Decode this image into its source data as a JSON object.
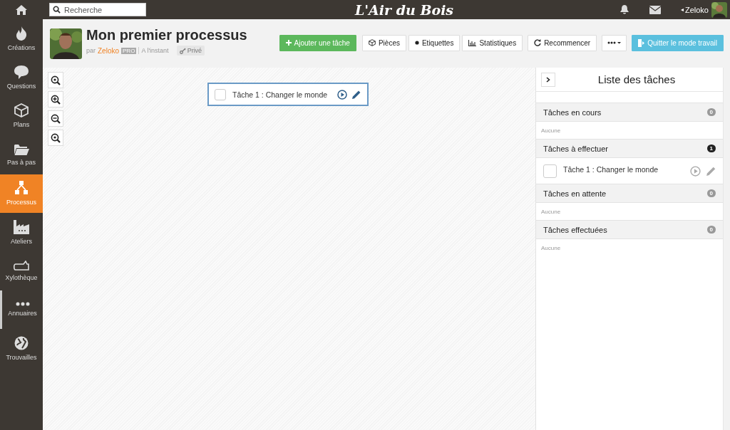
{
  "topbar": {
    "search": {
      "placeholder": "Recherche"
    },
    "logo": "L'Air du Bois",
    "user": {
      "caret": "◂",
      "name": "Zeloko"
    }
  },
  "sidebar": {
    "items": [
      {
        "label": "Créations",
        "selected": false,
        "highlighted": false
      },
      {
        "label": "Questions",
        "selected": false,
        "highlighted": false
      },
      {
        "label": "Plans",
        "selected": false,
        "highlighted": false
      },
      {
        "label": "Pas à pas",
        "selected": false,
        "highlighted": false
      },
      {
        "label": "Processus",
        "selected": true,
        "highlighted": false
      },
      {
        "label": "Ateliers",
        "selected": false,
        "highlighted": false
      },
      {
        "label": "Xylothèque",
        "selected": false,
        "highlighted": false
      },
      {
        "label": "Annuaires",
        "selected": false,
        "highlighted": true
      },
      {
        "label": "Trouvailles",
        "selected": false,
        "highlighted": false
      }
    ]
  },
  "header": {
    "title": "Mon premier processus",
    "by": "par",
    "author": "Zeloko",
    "badge": "PRO",
    "time": "A l'instant",
    "privacy": "Privé"
  },
  "buttons": [
    {
      "label": "Ajouter une tâche",
      "kind": "success"
    },
    {
      "label": "Pièces",
      "kind": "default"
    },
    {
      "label": "Etiquettes",
      "kind": "default"
    },
    {
      "label": "Statistiques",
      "kind": "default"
    },
    {
      "label": "Recommencer",
      "kind": "default"
    },
    {
      "kind": "more"
    },
    {
      "label": "Quitter le mode travail",
      "kind": "info"
    }
  ],
  "canvas": {
    "nodes": [
      {
        "label": "Tâche 1 : Changer le monde",
        "checked": false
      }
    ]
  },
  "task_list": {
    "title": "Liste des tâches",
    "sections": [
      {
        "title": "Tâches en cours",
        "count": "0",
        "highlighted": false,
        "empty_text": "Aucune"
      },
      {
        "title": "Tâches à effectuer",
        "count": "1",
        "highlighted": true,
        "tasks": [
          {
            "label": "Tâche 1 : Changer le monde",
            "checked": false
          }
        ]
      },
      {
        "title": "Tâches en attente",
        "count": "0",
        "highlighted": false,
        "empty_text": "Aucune"
      },
      {
        "title": "Tâches effectuées",
        "count": "0",
        "highlighted": false,
        "empty_text": "Aucune"
      }
    ]
  }
}
